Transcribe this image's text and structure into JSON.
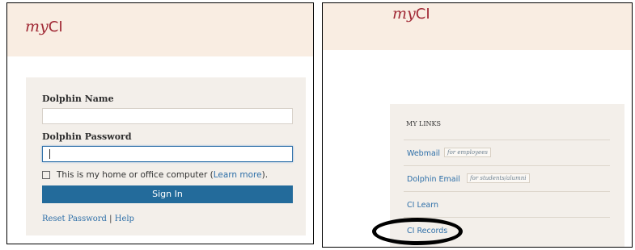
{
  "left": {
    "brand_my": "my",
    "brand_ci": "CI",
    "name_label": "Dolphin Name",
    "password_label": "Dolphin Password",
    "remember_text": "This is my home or office computer (",
    "learn_more": "Learn more",
    "remember_end": ").",
    "sign_in": "Sign In",
    "reset_password": "Reset Password",
    "separator": "|",
    "help": "Help"
  },
  "right": {
    "brand_my": "my",
    "brand_ci": "CI",
    "links_heading": "MY LINKS",
    "links": [
      {
        "label": "Webmail",
        "tag": "for employees"
      },
      {
        "label": "Dolphin Email",
        "tag": "for students/alumni"
      },
      {
        "label": "CI Learn",
        "tag": ""
      },
      {
        "label": "CI Records",
        "tag": ""
      }
    ]
  },
  "colors": {
    "brand": "#a12a36",
    "header_bg": "#f9ede2",
    "card_bg": "#f3efea",
    "button": "#236b9b",
    "link": "#2e6fa8"
  }
}
